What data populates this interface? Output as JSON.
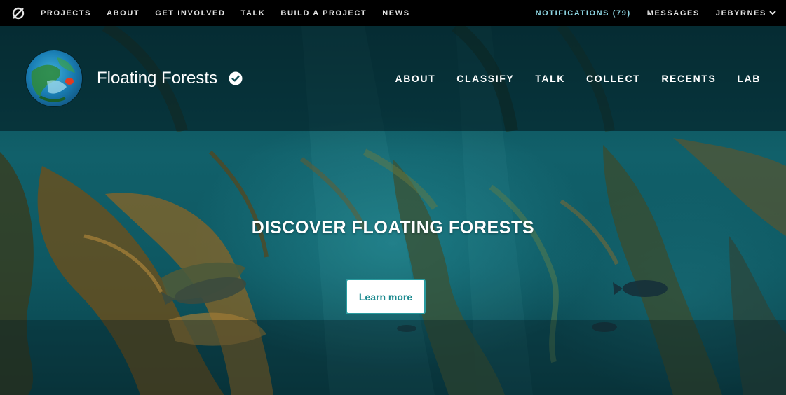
{
  "topnav": {
    "logo_icon": "zooniverse-logo-icon",
    "items": [
      {
        "label": "PROJECTS"
      },
      {
        "label": "ABOUT"
      },
      {
        "label": "GET INVOLVED"
      },
      {
        "label": "TALK"
      },
      {
        "label": "BUILD A PROJECT"
      },
      {
        "label": "NEWS"
      }
    ],
    "notifications": "NOTIFICATIONS (79)",
    "messages": "MESSAGES",
    "user": "JEBYRNES",
    "user_menu_icon": "chevron-down-icon"
  },
  "project": {
    "title": "Floating Forests",
    "verified_icon": "verified-check-icon",
    "nav": [
      {
        "label": "ABOUT"
      },
      {
        "label": "CLASSIFY"
      },
      {
        "label": "TALK"
      },
      {
        "label": "COLLECT"
      },
      {
        "label": "RECENTS"
      },
      {
        "label": "LAB"
      }
    ]
  },
  "hero": {
    "heading": "DISCOVER FLOATING FORESTS",
    "button_label": "Learn more"
  },
  "colors": {
    "topbar_bg": "#000000",
    "notification_accent": "#8fd6e3",
    "button_border": "#2a9b9f",
    "button_text": "#1c8a8f",
    "hero_tone": "#11606a"
  }
}
